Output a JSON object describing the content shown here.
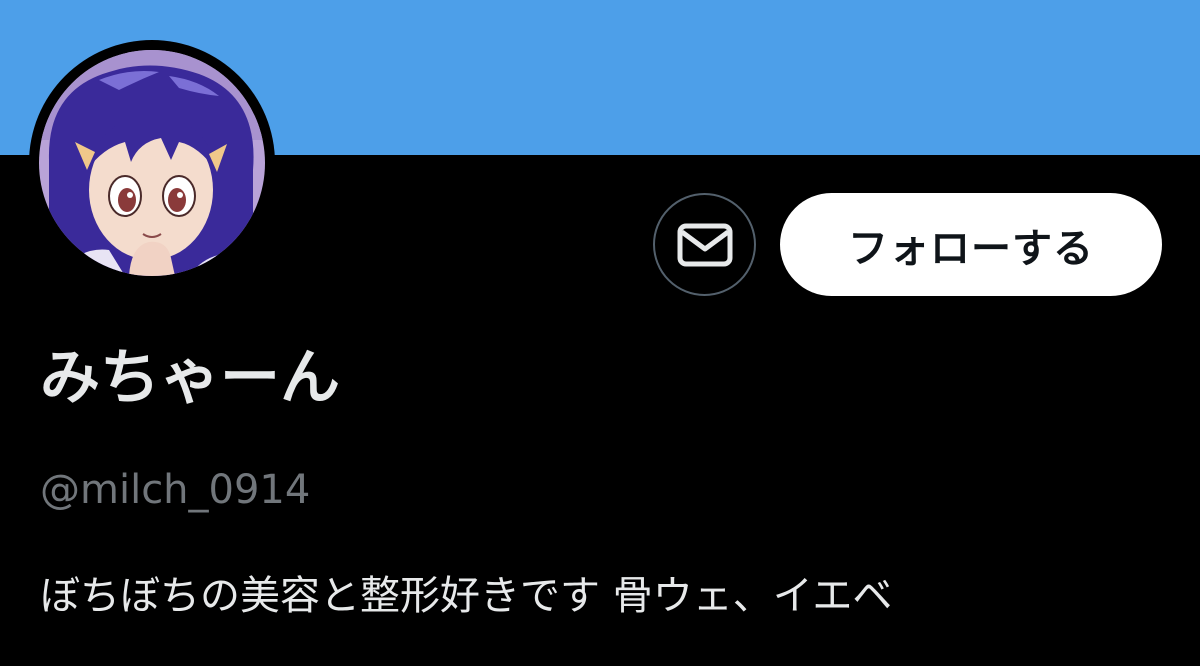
{
  "colors": {
    "banner": "#4d9fe9",
    "background": "#000000",
    "primary_text": "#e7e9ea",
    "secondary_text": "#71767b",
    "button_border": "#53606c",
    "follow_button_bg": "#ffffff",
    "follow_button_text": "#0f1419"
  },
  "profile": {
    "avatar_icon": "anime-character-avatar",
    "display_name": "みちゃーん",
    "handle": "@milch_0914",
    "bio": "ぼちぼちの美容と整形好きです 骨ウェ、イエベ"
  },
  "actions": {
    "message_icon": "envelope-icon",
    "follow_label": "フォローする"
  }
}
